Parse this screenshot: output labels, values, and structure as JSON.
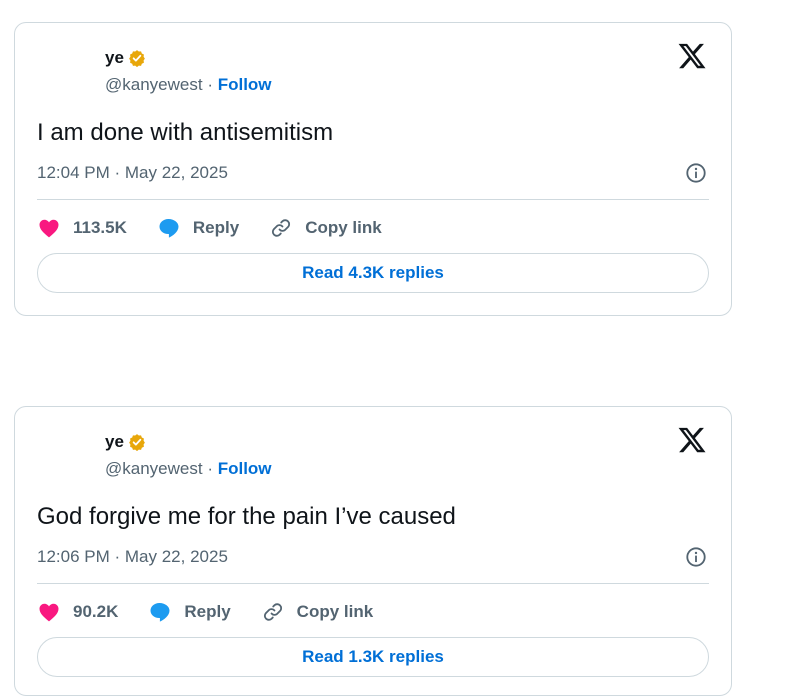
{
  "colors": {
    "text": "#0f1419",
    "secondary": "#536471",
    "link": "#006fd6",
    "border": "#cfd9de",
    "heart": "#f91880",
    "reply_bubble": "#1d9bf0",
    "verified_badge": "#e8a70a"
  },
  "tweets": [
    {
      "author_name": "ye",
      "handle": "@kanyewest",
      "separator": "·",
      "follow_label": "Follow",
      "text": "I am done with antisemitism",
      "time": "12:04 PM",
      "date": "May 22, 2025",
      "likes": "113.5K",
      "reply_label": "Reply",
      "copy_link_label": "Copy link",
      "read_replies_label": "Read 4.3K replies",
      "icons": [
        "verified-badge-icon",
        "x-logo-icon",
        "info-icon",
        "heart-icon",
        "reply-bubble-icon",
        "link-icon"
      ]
    },
    {
      "author_name": "ye",
      "handle": "@kanyewest",
      "separator": "·",
      "follow_label": "Follow",
      "text": "God forgive me for the pain I’ve caused",
      "time": "12:06 PM",
      "date": "May 22, 2025",
      "likes": "90.2K",
      "reply_label": "Reply",
      "copy_link_label": "Copy link",
      "read_replies_label": "Read 1.3K replies",
      "icons": [
        "verified-badge-icon",
        "x-logo-icon",
        "info-icon",
        "heart-icon",
        "reply-bubble-icon",
        "link-icon"
      ]
    }
  ]
}
